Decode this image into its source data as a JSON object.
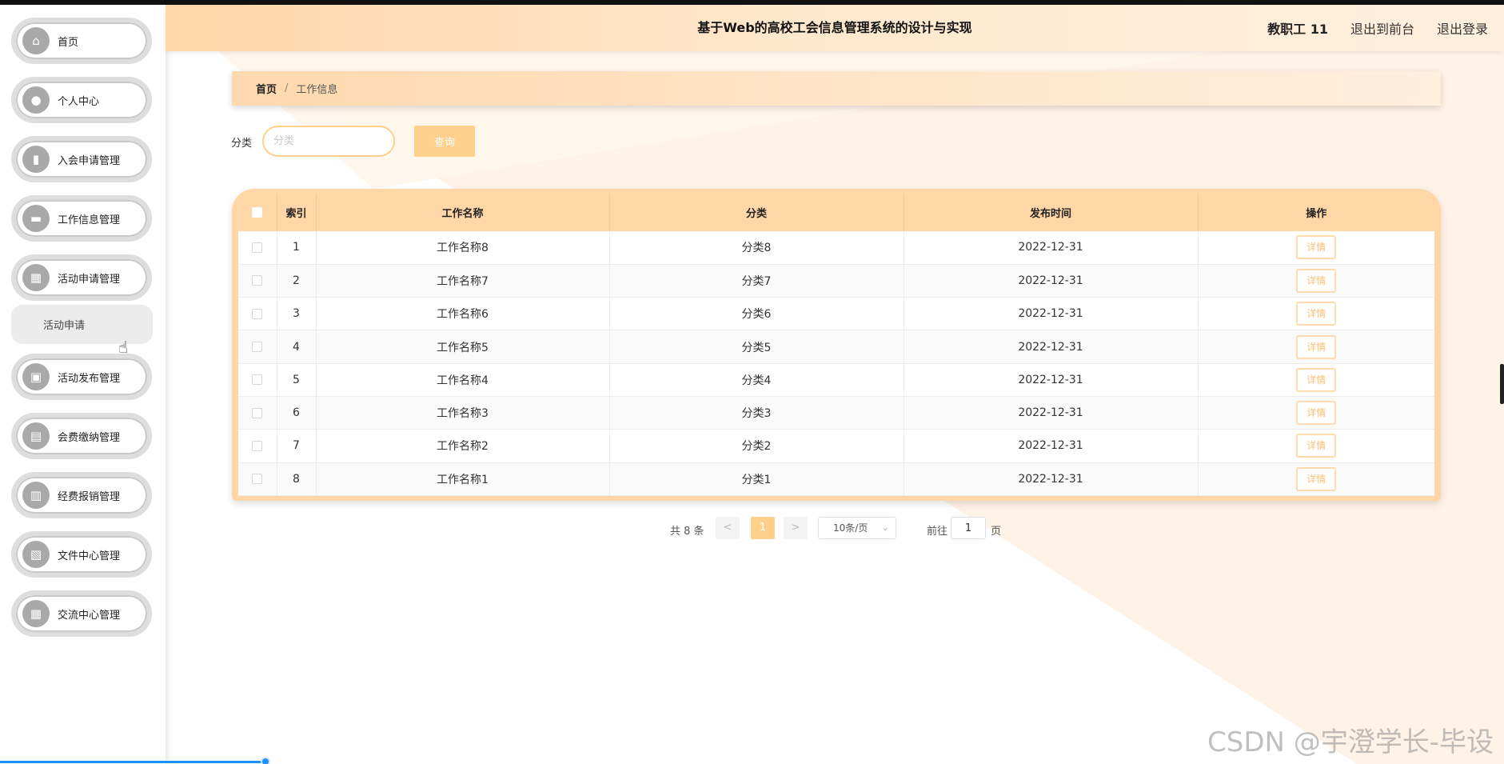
{
  "header": {
    "title": "基于Web的高校工会信息管理系统的设计与实现",
    "user": "教职工 11",
    "back_front": "退出到前台",
    "logout": "退出登录"
  },
  "sidebar": {
    "items": [
      {
        "label": "首页",
        "icon": "home-icon",
        "glyph": "⌂"
      },
      {
        "label": "个人中心",
        "icon": "user-icon",
        "glyph": "●"
      },
      {
        "label": "入会申请管理",
        "icon": "bar-chart-icon",
        "glyph": "▮"
      },
      {
        "label": "工作信息管理",
        "icon": "chat-icon",
        "glyph": "▬"
      },
      {
        "label": "活动申请管理",
        "icon": "grid-icon",
        "glyph": "▦"
      },
      {
        "label": "活动发布管理",
        "icon": "clipboard-icon",
        "glyph": "▣"
      },
      {
        "label": "会费缴纳管理",
        "icon": "briefcase-icon",
        "glyph": "▤"
      },
      {
        "label": "经费报销管理",
        "icon": "document-icon",
        "glyph": "▥"
      },
      {
        "label": "文件中心管理",
        "icon": "picture-icon",
        "glyph": "▧"
      },
      {
        "label": "交流中心管理",
        "icon": "grid-icon",
        "glyph": "▦"
      }
    ],
    "sub_item": "活动申请"
  },
  "breadcrumb": {
    "home": "首页",
    "separator": "/",
    "current": "工作信息"
  },
  "search": {
    "label": "分类",
    "placeholder": "分类",
    "button": "查询"
  },
  "table": {
    "columns": [
      "索引",
      "工作名称",
      "分类",
      "发布时间",
      "操作"
    ],
    "action_label": "详情",
    "rows": [
      {
        "index": "1",
        "name": "工作名称8",
        "category": "分类8",
        "date": "2022-12-31"
      },
      {
        "index": "2",
        "name": "工作名称7",
        "category": "分类7",
        "date": "2022-12-31"
      },
      {
        "index": "3",
        "name": "工作名称6",
        "category": "分类6",
        "date": "2022-12-31"
      },
      {
        "index": "4",
        "name": "工作名称5",
        "category": "分类5",
        "date": "2022-12-31"
      },
      {
        "index": "5",
        "name": "工作名称4",
        "category": "分类4",
        "date": "2022-12-31"
      },
      {
        "index": "6",
        "name": "工作名称3",
        "category": "分类3",
        "date": "2022-12-31"
      },
      {
        "index": "7",
        "name": "工作名称2",
        "category": "分类2",
        "date": "2022-12-31"
      },
      {
        "index": "8",
        "name": "工作名称1",
        "category": "分类1",
        "date": "2022-12-31"
      }
    ]
  },
  "pagination": {
    "total": "共 8 条",
    "prev": "<",
    "current_page": "1",
    "next": ">",
    "page_size": "10条/页",
    "goto_label": "前往",
    "goto_value": "1",
    "page_suffix": "页"
  },
  "watermark": "CSDN @宇澄学长-毕设",
  "colors": {
    "accent": "#ffcf8c",
    "header": "#ffd7a8",
    "table_header": "#ffd7a6",
    "sidebar_icon": "#a9a9a9"
  }
}
